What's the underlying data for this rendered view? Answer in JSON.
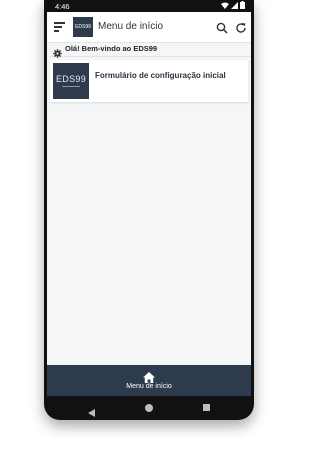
{
  "status_bar": {
    "time": "4:46"
  },
  "app_bar": {
    "logo_text": "EDS99",
    "title": "Menu de início"
  },
  "welcome": {
    "text": "Olá! Bem-vindo ao EDS99"
  },
  "cards": [
    {
      "logo_text": "EDS99",
      "title": "Formulário de configuração inicial"
    }
  ],
  "bottom_nav": {
    "label": "Menu de início"
  },
  "colors": {
    "primary": "#2d3b4d",
    "background": "#f5f6f8"
  },
  "icons": [
    "menu-icon",
    "search-icon",
    "refresh-icon",
    "gear-icon",
    "home-icon",
    "back-icon",
    "home-circle-icon",
    "recents-icon"
  ]
}
